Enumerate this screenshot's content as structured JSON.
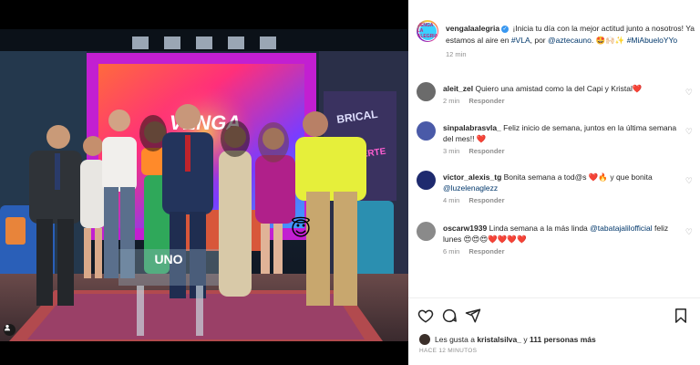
{
  "post": {
    "author": "vengalaalegria",
    "avatar_text": "VENGA LA ALEGRIA",
    "caption_parts": [
      {
        "t": "¡Inicia tu día con la mejor actitud junto a nosotros! Ya estamos al aire en ",
        "link": false
      },
      {
        "t": "#VLA",
        "link": true
      },
      {
        "t": ", por ",
        "link": false
      },
      {
        "t": "@aztecauno",
        "link": true
      },
      {
        "t": ". 🤩🙌🏻✨ ",
        "link": false
      },
      {
        "t": "#MiAbueloYYo",
        "link": true
      }
    ],
    "time": "12 min",
    "media": {
      "stage_logo": "VENGA",
      "desk_logo": "UNO",
      "side_sign_1": "BRICAL",
      "side_sign_2": "DIVIERTE",
      "sticker": "😇"
    }
  },
  "comments": [
    {
      "user": "aleit_zel",
      "avatar_color": "#6b6b6b",
      "parts": [
        {
          "t": "Quiero una amistad como la del Capi y Kristal",
          "link": false
        },
        {
          "t": "❤️",
          "link": false
        }
      ],
      "time": "2 min",
      "reply": "Responder"
    },
    {
      "user": "sinpalabrasvla_",
      "avatar_color": "#4a5aa8",
      "parts": [
        {
          "t": "Feliz inicio de semana, juntos en la última semana del mes!! ❤️",
          "link": false
        }
      ],
      "time": "3 min",
      "reply": "Responder"
    },
    {
      "user": "victor_alexis_tg",
      "avatar_color": "#1e2a6e",
      "parts": [
        {
          "t": "Bonita semana a tod@s ❤️🔥 y que bonita ",
          "link": false
        },
        {
          "t": "@luzelenaglezz",
          "link": true
        }
      ],
      "time": "4 min",
      "reply": "Responder"
    },
    {
      "user": "oscarw1939",
      "avatar_color": "#8a8a8a",
      "parts": [
        {
          "t": "Linda semana a la más linda ",
          "link": false
        },
        {
          "t": "@tabatajalilofficial",
          "link": true
        },
        {
          "t": " feliz lunes 😍😍😍❤️❤️❤️❤️",
          "link": false
        }
      ],
      "time": "6 min",
      "reply": "Responder"
    }
  ],
  "likes": {
    "prefix": "Les gusta a ",
    "user": "kristalsilva_",
    "middle": " y ",
    "others": "111 personas más"
  },
  "posted_ago": "HACE 12 MINUTOS",
  "icons": [
    "heart-icon",
    "comment-icon",
    "share-icon",
    "bookmark-icon",
    "user-tag-icon",
    "verified-badge"
  ],
  "colors": {
    "link": "#00376b",
    "muted": "#8e8e8e",
    "verified": "#3897f0",
    "stage_frame": "#c21fd1"
  }
}
